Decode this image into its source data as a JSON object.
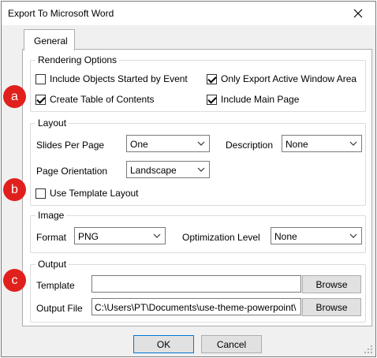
{
  "dialog": {
    "title": "Export To Microsoft Word",
    "close_icon": "close-icon"
  },
  "tabs": [
    {
      "label": "General",
      "selected": true
    }
  ],
  "rendering": {
    "legend": "Rendering Options",
    "include_objects": {
      "label": "Include Objects Started by Event",
      "checked": false
    },
    "only_export": {
      "label": "Only Export Active Window Area",
      "checked": true
    },
    "create_toc": {
      "label": "Create Table of Contents",
      "checked": true
    },
    "include_main": {
      "label": "Include Main Page",
      "checked": true
    }
  },
  "layout": {
    "legend": "Layout",
    "slides_label": "Slides Per Page",
    "slides_value": "One",
    "description_label": "Description",
    "description_value": "None",
    "orientation_label": "Page Orientation",
    "orientation_value": "Landscape",
    "use_template": {
      "label": "Use Template Layout",
      "checked": false
    }
  },
  "image": {
    "legend": "Image",
    "format_label": "Format",
    "format_value": "PNG",
    "optimization_label": "Optimization Level",
    "optimization_value": "None"
  },
  "output": {
    "legend": "Output",
    "template_label": "Template",
    "template_value": "",
    "output_file_label": "Output File",
    "output_file_value": "C:\\Users\\PT\\Documents\\use-theme-powerpoint\\",
    "browse_label": "Browse"
  },
  "footer": {
    "ok_label": "OK",
    "cancel_label": "Cancel"
  },
  "markers": {
    "a": "a",
    "b": "b",
    "c": "c"
  },
  "colors": {
    "marker": "#e0201c",
    "dialog_bg": "#f0f0f0",
    "panel_bg": "#ffffff"
  }
}
